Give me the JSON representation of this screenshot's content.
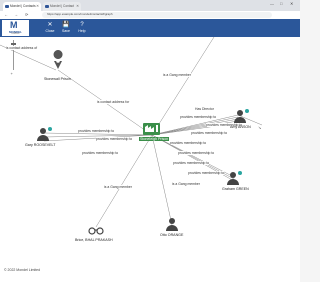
{
  "browser": {
    "tabs": [
      {
        "label": "Mondel | Contacts",
        "active": true
      },
      {
        "label": "Mondel | Contact",
        "active": false
      }
    ],
    "controls": {
      "minimize": "—",
      "maximize": "□",
      "close": "✕"
    },
    "nav": {
      "back": "←",
      "forward": "→",
      "reload": "⟳"
    },
    "url": "https://app.example.com/mondel/contacts#/graph"
  },
  "toolbar": {
    "logo_mark": "M",
    "logo_text": "MONDEL",
    "logo_sub": "LIMITED",
    "buttons": [
      {
        "label": "Close",
        "icon": "✕"
      },
      {
        "label": "Save",
        "icon": "💾"
      },
      {
        "label": "Help",
        "icon": "?"
      }
    ]
  },
  "graph": {
    "labels": {
      "contact_address": "is contact address of",
      "centre": "Stoneleigh Prison",
      "prison": "Stonewall Prison",
      "is_contact_address_for": "is contact address for",
      "gang_member_top": "is a Gang member",
      "has_director": "Has Director",
      "pm1": "provides membership to",
      "pm2": "provides membership to",
      "pm3": "provides membership to",
      "pm4": "provides membership to",
      "pm5": "provides membership to",
      "pm6": "provides membership to",
      "pm7": "provides membership to",
      "pm8": "provides membership to",
      "pm9": "provides membership to",
      "pm10": "provides membership to",
      "gang_member_left": "is a Gang member",
      "gang_member_right": "is a Gang member"
    },
    "people": {
      "anson": "Amy ANSON",
      "roosevelt": "Gary ROOSEVELT",
      "green": "Graham GREEN",
      "orange": "Otto ORANGE",
      "brice": "Brice, BHAL PRAKASH"
    }
  },
  "footer": "© 2022 Mondel Limited"
}
